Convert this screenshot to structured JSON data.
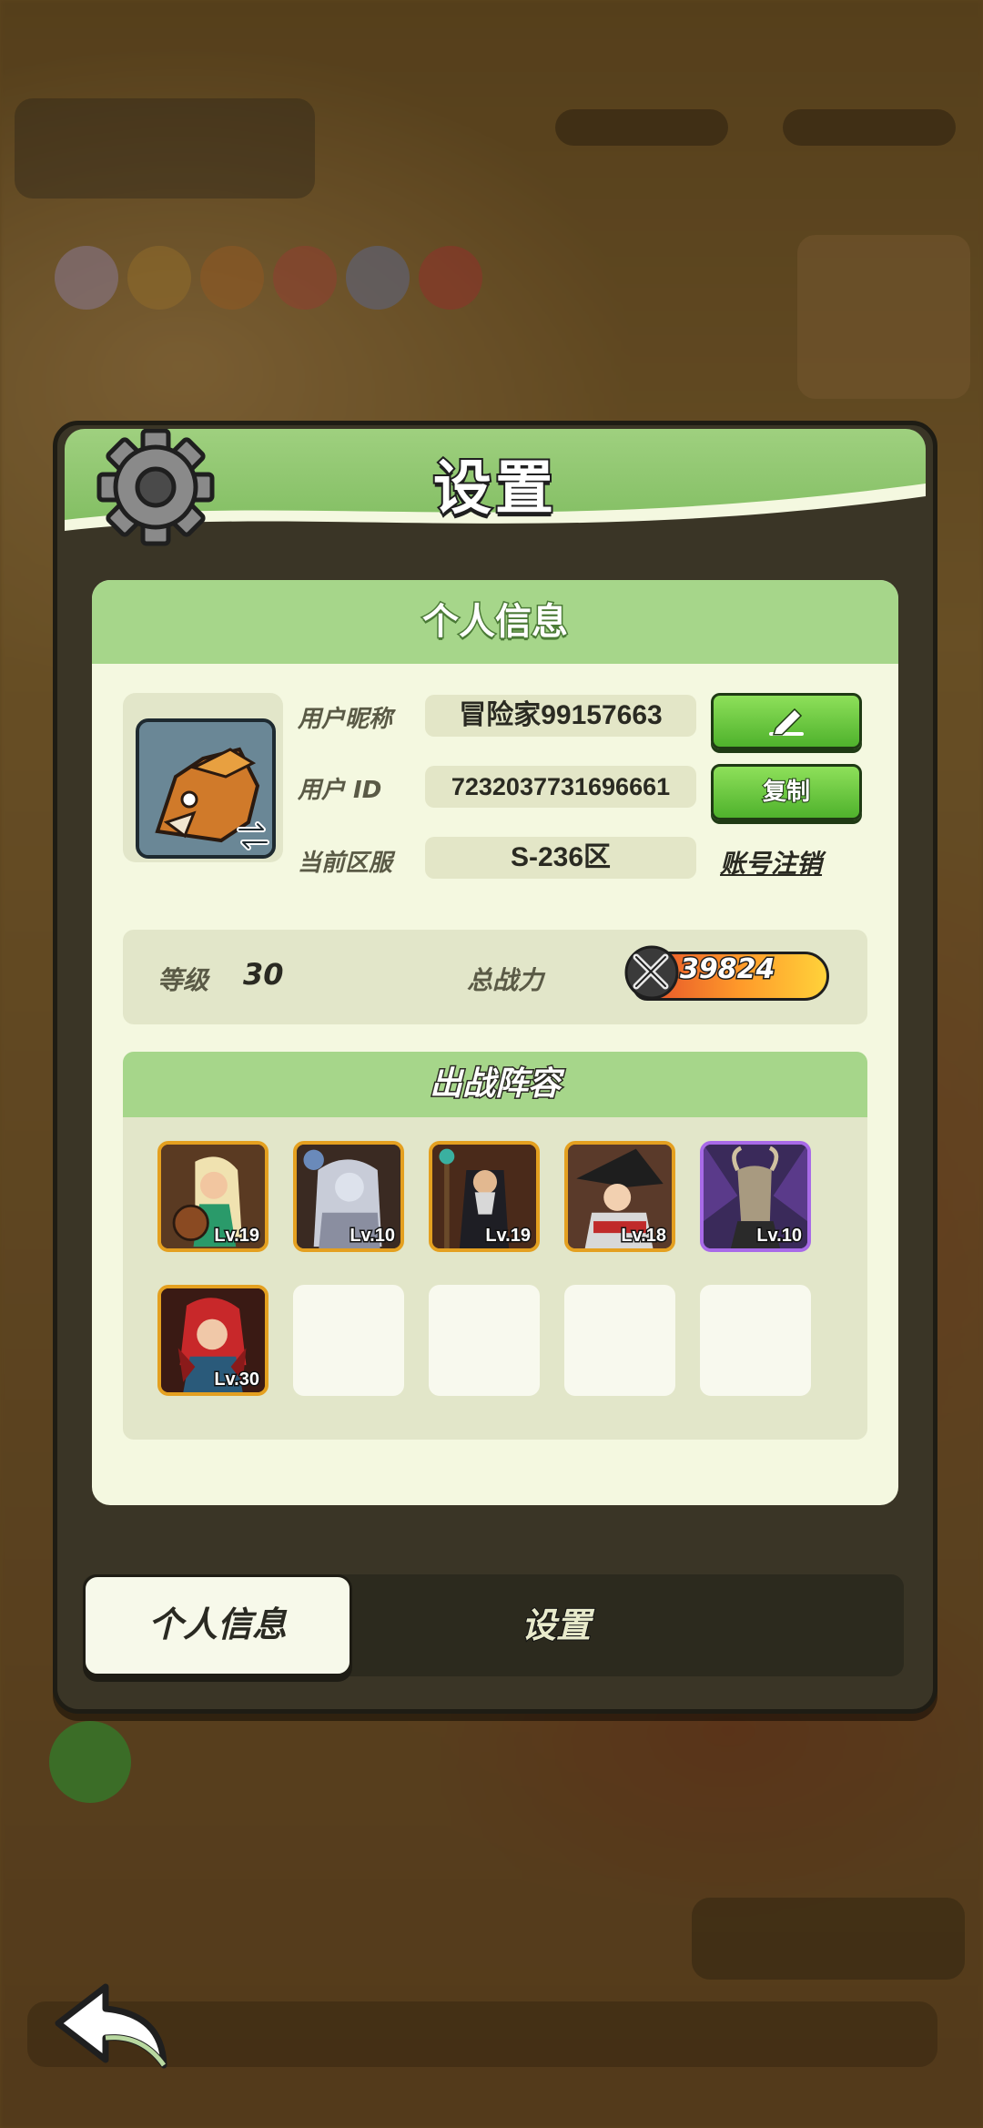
{
  "dialog": {
    "title": "设置",
    "panel_title": "个人信息",
    "profile": {
      "nickname_label": "用户昵称",
      "nickname_value": "冒险家99157663",
      "id_label": "用户  ID",
      "id_value": "7232037731696661",
      "server_label": "当前区服",
      "server_value": "S-236区",
      "copy_label": "复制",
      "deregister_label": "账号注销"
    },
    "stats": {
      "level_label": "等级",
      "level_value": "30",
      "power_label": "总战力",
      "power_value": "39824"
    },
    "lineup": {
      "title": "出战阵容",
      "heroes": [
        {
          "level": "Lv.19",
          "frame": "gold"
        },
        {
          "level": "Lv.10",
          "frame": "gold"
        },
        {
          "level": "Lv.19",
          "frame": "gold"
        },
        {
          "level": "Lv.18",
          "frame": "gold"
        },
        {
          "level": "Lv.10",
          "frame": "purple"
        },
        {
          "level": "Lv.30",
          "frame": "gold"
        }
      ],
      "empty_slots": 4
    },
    "tabs": [
      {
        "label": "个人信息",
        "active": true
      },
      {
        "label": "设置",
        "active": false
      }
    ]
  },
  "colors": {
    "header_green": "#7cba5c",
    "panel_bg": "#f4f8e0",
    "button_green": "#4fb22c",
    "gold_frame": "#e4a020",
    "purple_frame": "#a86ae8"
  },
  "icons": [
    "gear-icon",
    "edit-pencil-icon",
    "swap-icon",
    "crossed-swords-icon",
    "back-arrow-icon"
  ]
}
